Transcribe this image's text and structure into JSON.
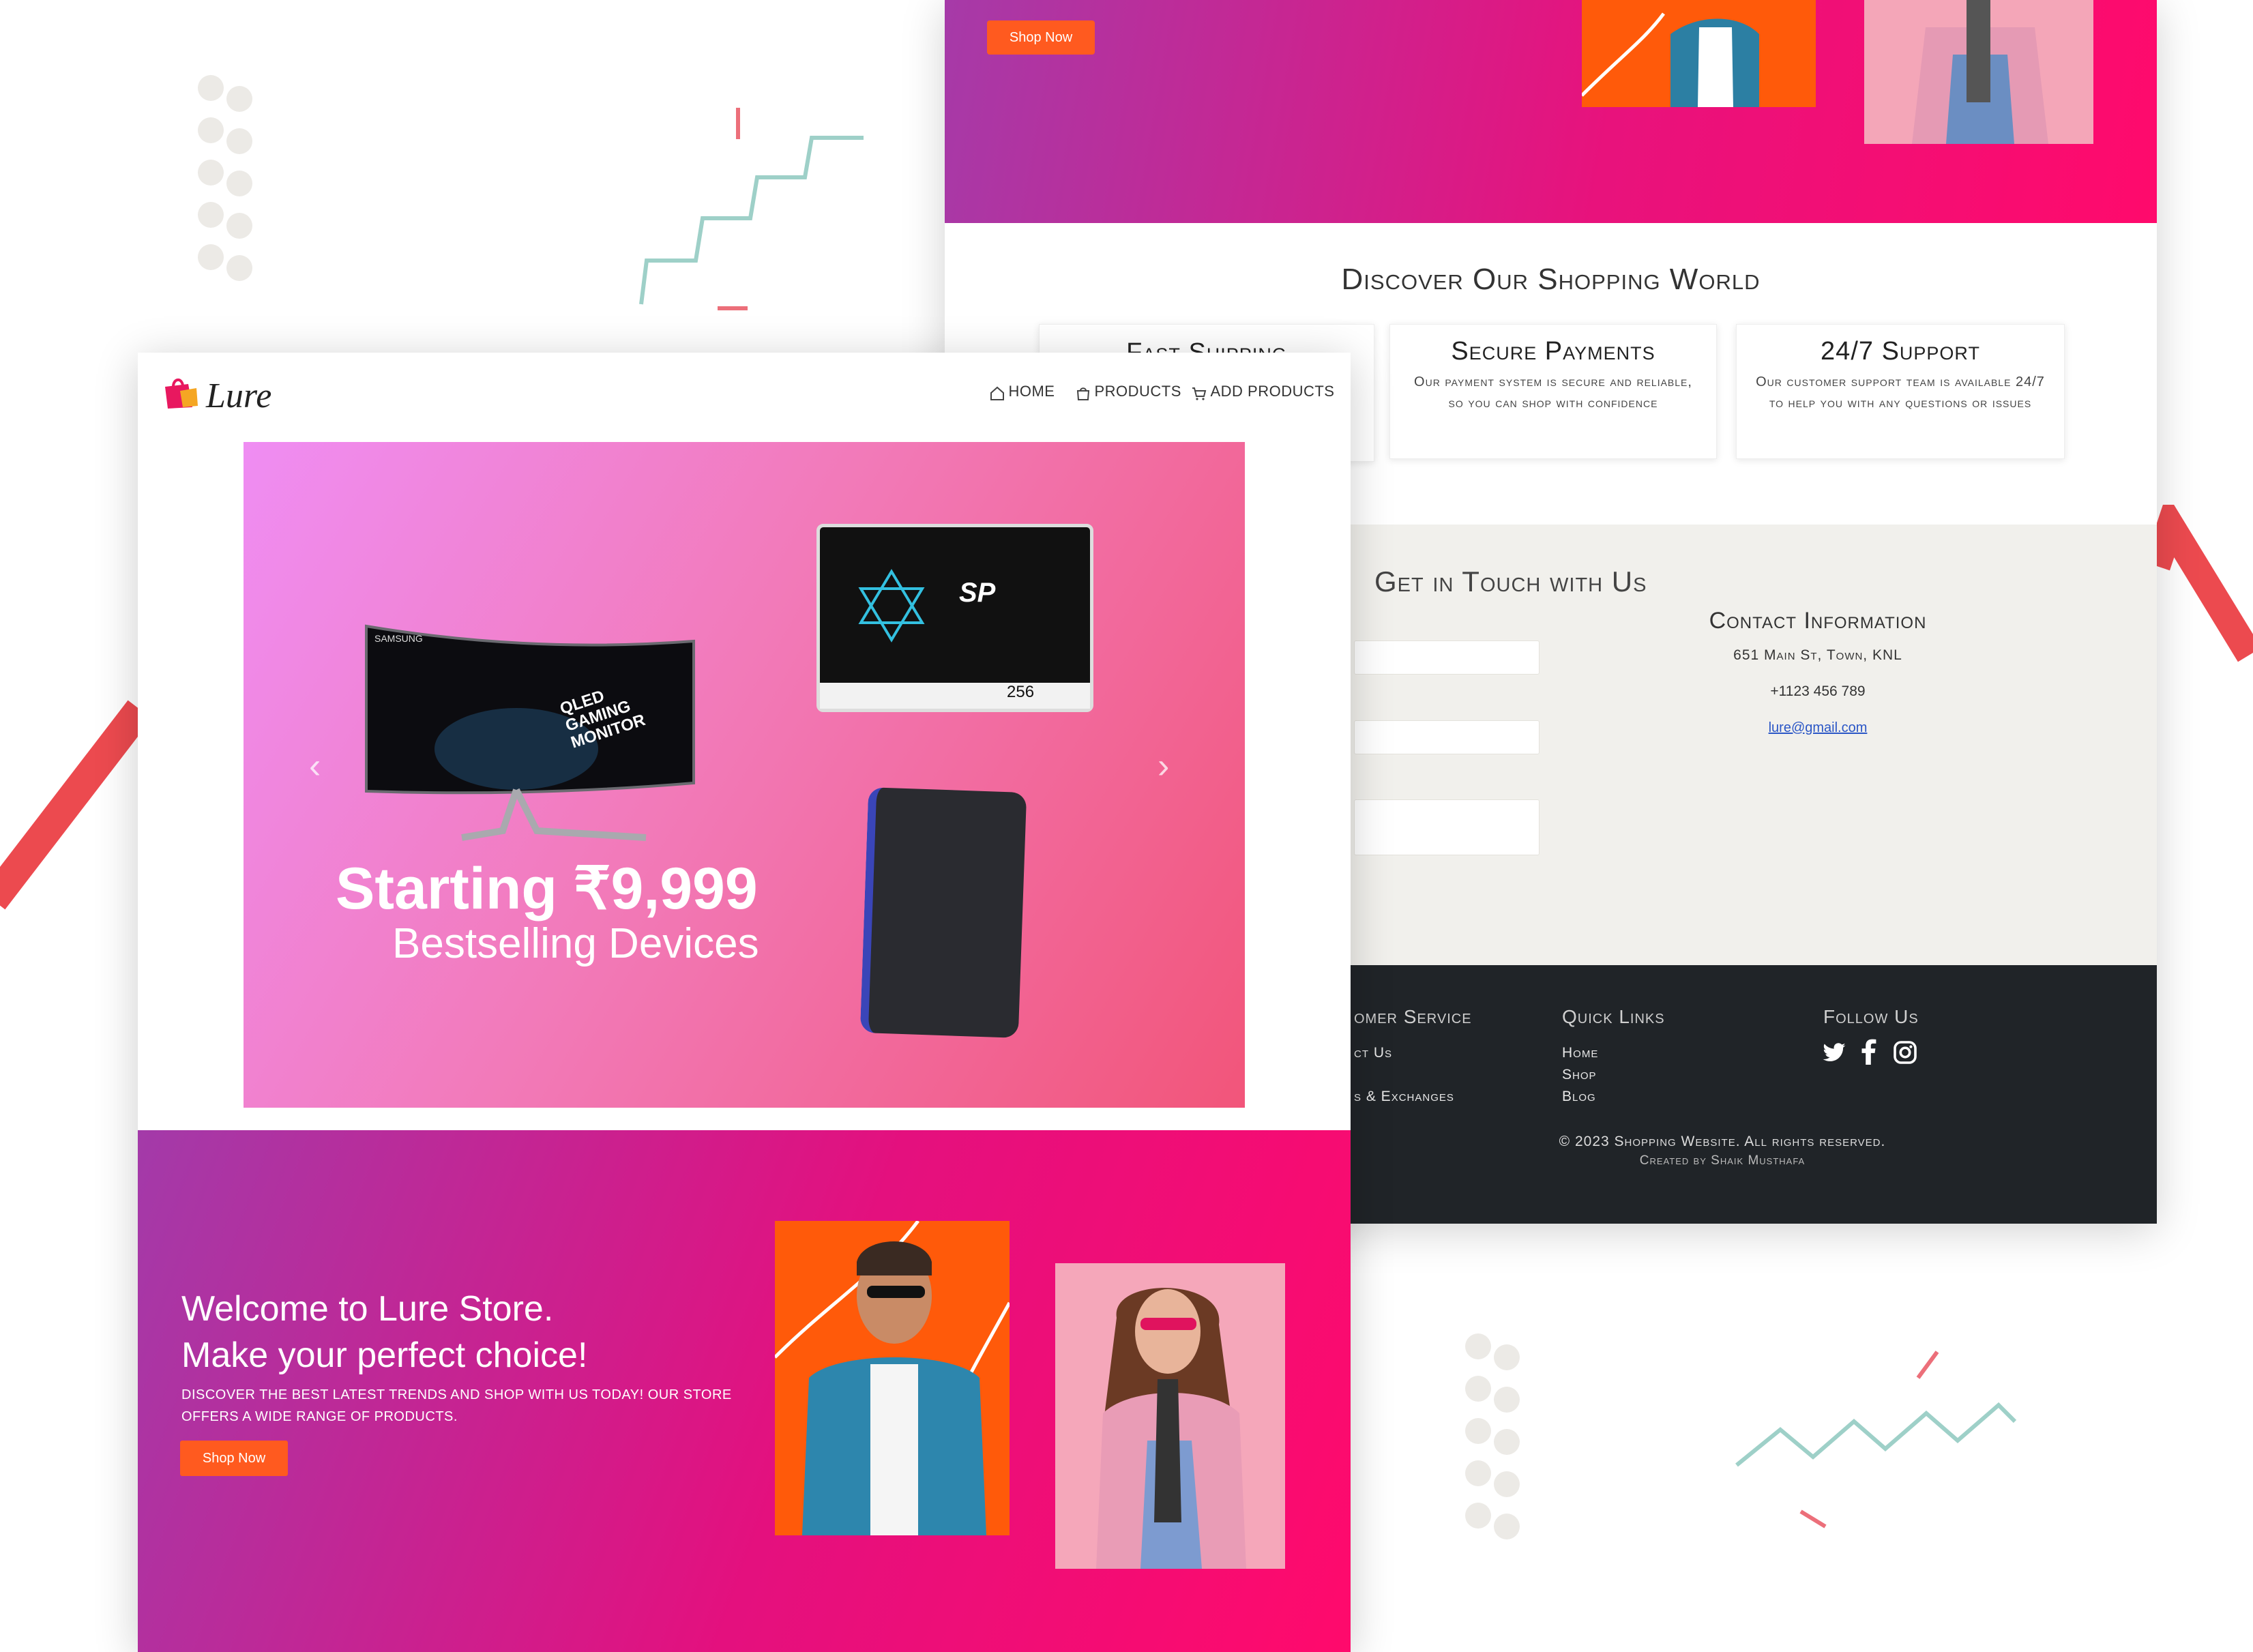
{
  "brand": {
    "name": "Lure"
  },
  "nav": {
    "items": [
      {
        "label": "HOME",
        "icon": "home-icon"
      },
      {
        "label": "PRODUCTS",
        "icon": "bag-icon"
      },
      {
        "label": "ADD PRODUCTS",
        "icon": "cart-icon"
      }
    ]
  },
  "carousel": {
    "headline": "Starting ₹9,999",
    "subtitle": "Bestselling Devices",
    "monitor_text": "QLED GAMING MONITOR",
    "monitor_brand": "SAMSUNG",
    "ssd_brand": "SP",
    "ssd_capacity": "256",
    "prev_icon": "chevron-left-icon",
    "next_icon": "chevron-right-icon"
  },
  "welcome": {
    "line1": "Welcome to Lure Store.",
    "line2": "Make your perfect choice!",
    "description": "DISCOVER THE BEST LATEST TRENDS AND SHOP WITH US TODAY! OUR STORE OFFERS A WIDE RANGE OF PRODUCTS.",
    "shop_button": "Shop Now"
  },
  "discover": {
    "title": "Discover Our Shopping World",
    "features": [
      {
        "title": "Fast Shipping",
        "text": ""
      },
      {
        "title": "Secure Payments",
        "text": "Our payment system is secure and reliable, so you can shop with confidence"
      },
      {
        "title": "24/7 Support",
        "text": "Our customer support team is available 24/7 to help you with any questions or issues"
      }
    ]
  },
  "contact": {
    "title": "Get in Touch with Us",
    "info_title": "Contact Information",
    "address": "651 Main St, Town, KNL",
    "phone": "+1123 456 789",
    "email": "lure@gmail.com"
  },
  "footer": {
    "customer_service": {
      "title": "omer Service",
      "links": [
        "ct Us",
        "s & Exchanges"
      ]
    },
    "quick_links": {
      "title": "Quick Links",
      "links": [
        "Home",
        "Shop",
        "Blog"
      ]
    },
    "follow": {
      "title": "Follow Us",
      "icons": [
        "twitter-icon",
        "facebook-icon",
        "instagram-icon"
      ]
    },
    "copyright": "© 2023 Shopping Website. All rights reserved.",
    "credit": "Created by Shaik Musthafa"
  },
  "colors": {
    "accent_orange": "#ff5a1f",
    "hero_pink": "#e8127c",
    "hero_purple": "#a63aa8",
    "footer_dark": "#202428",
    "contact_bg": "#f1f0ec",
    "deco_red": "#ec4a4f",
    "deco_teal": "#9ed0c8"
  }
}
